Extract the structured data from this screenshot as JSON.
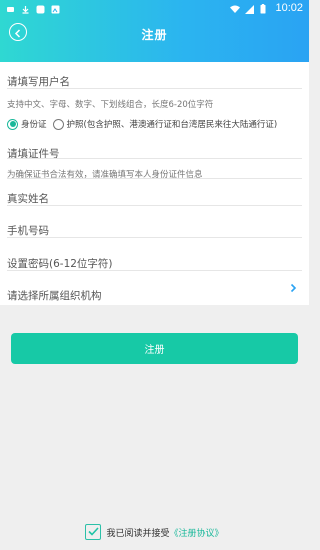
{
  "status_bar": {
    "time": "10:02"
  },
  "header": {
    "title": "注册"
  },
  "form": {
    "username": {
      "placeholder": "请填写用户名",
      "hint": "支持中文、字母、数字、下划线组合，长度6-20位字符"
    },
    "id_type": {
      "selected": "身份证",
      "options": [
        {
          "label": "身份证",
          "selected": true
        },
        {
          "label": "护照(包含护照、港澳通行证和台湾居民来往大陆通行证)",
          "selected": false
        }
      ]
    },
    "id_number": {
      "placeholder": "请填证件号",
      "hint": "为确保证书合法有效，请准确填写本人身份证件信息"
    },
    "real_name": {
      "placeholder": "真实姓名"
    },
    "phone": {
      "placeholder": "手机号码"
    },
    "password": {
      "placeholder": "设置密码(6-12位字符)"
    },
    "organization": {
      "placeholder": "请选择所属组织机构"
    }
  },
  "actions": {
    "submit_label": "注册"
  },
  "agreement": {
    "prefix": "我已阅读并接受",
    "link_text": "《注册协议》",
    "checked": true
  },
  "colors": {
    "accent": "#17c9a6",
    "header_start": "#2fd8d2",
    "header_end": "#2aa3f3"
  }
}
